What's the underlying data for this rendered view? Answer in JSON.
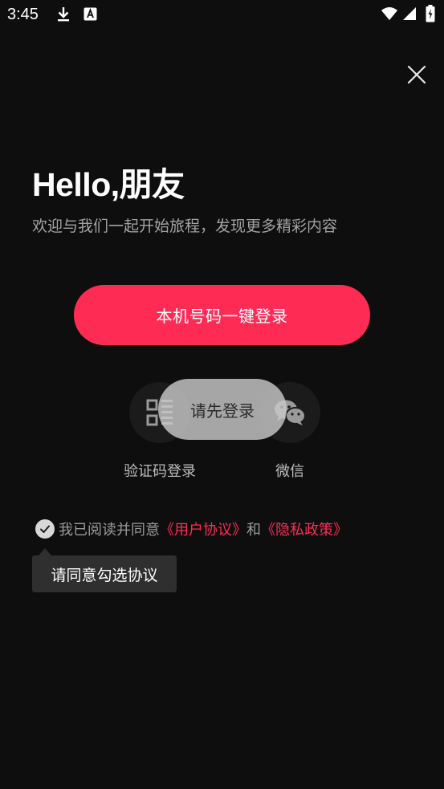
{
  "status_bar": {
    "time": "3:45",
    "left_icons": [
      "download-icon",
      "font-icon"
    ],
    "right_icons": [
      "wifi-icon",
      "signal-icon",
      "battery-charging-icon"
    ]
  },
  "close": {
    "icon": "close-icon"
  },
  "header": {
    "title": "Hello,朋友",
    "subtitle": "欢迎与我们一起开始旅程，发现更多精彩内容"
  },
  "primary_login": {
    "label": "本机号码一键登录"
  },
  "alt_logins": [
    {
      "label": "验证码登录",
      "icon": "qr-code-icon"
    },
    {
      "label": "微信",
      "icon": "wechat-icon"
    }
  ],
  "toast": {
    "text": "请先登录"
  },
  "agreement": {
    "prefix": "我已阅读并同意",
    "user_agreement": "《用户协议》",
    "conjunction": "和",
    "privacy_policy": "《隐私政策》",
    "checked": false
  },
  "tooltip": {
    "text": "请同意勾选协议"
  },
  "colors": {
    "background": "#0e0e0e",
    "accent": "#fe2c55",
    "subtitle": "#a3a3a3"
  }
}
